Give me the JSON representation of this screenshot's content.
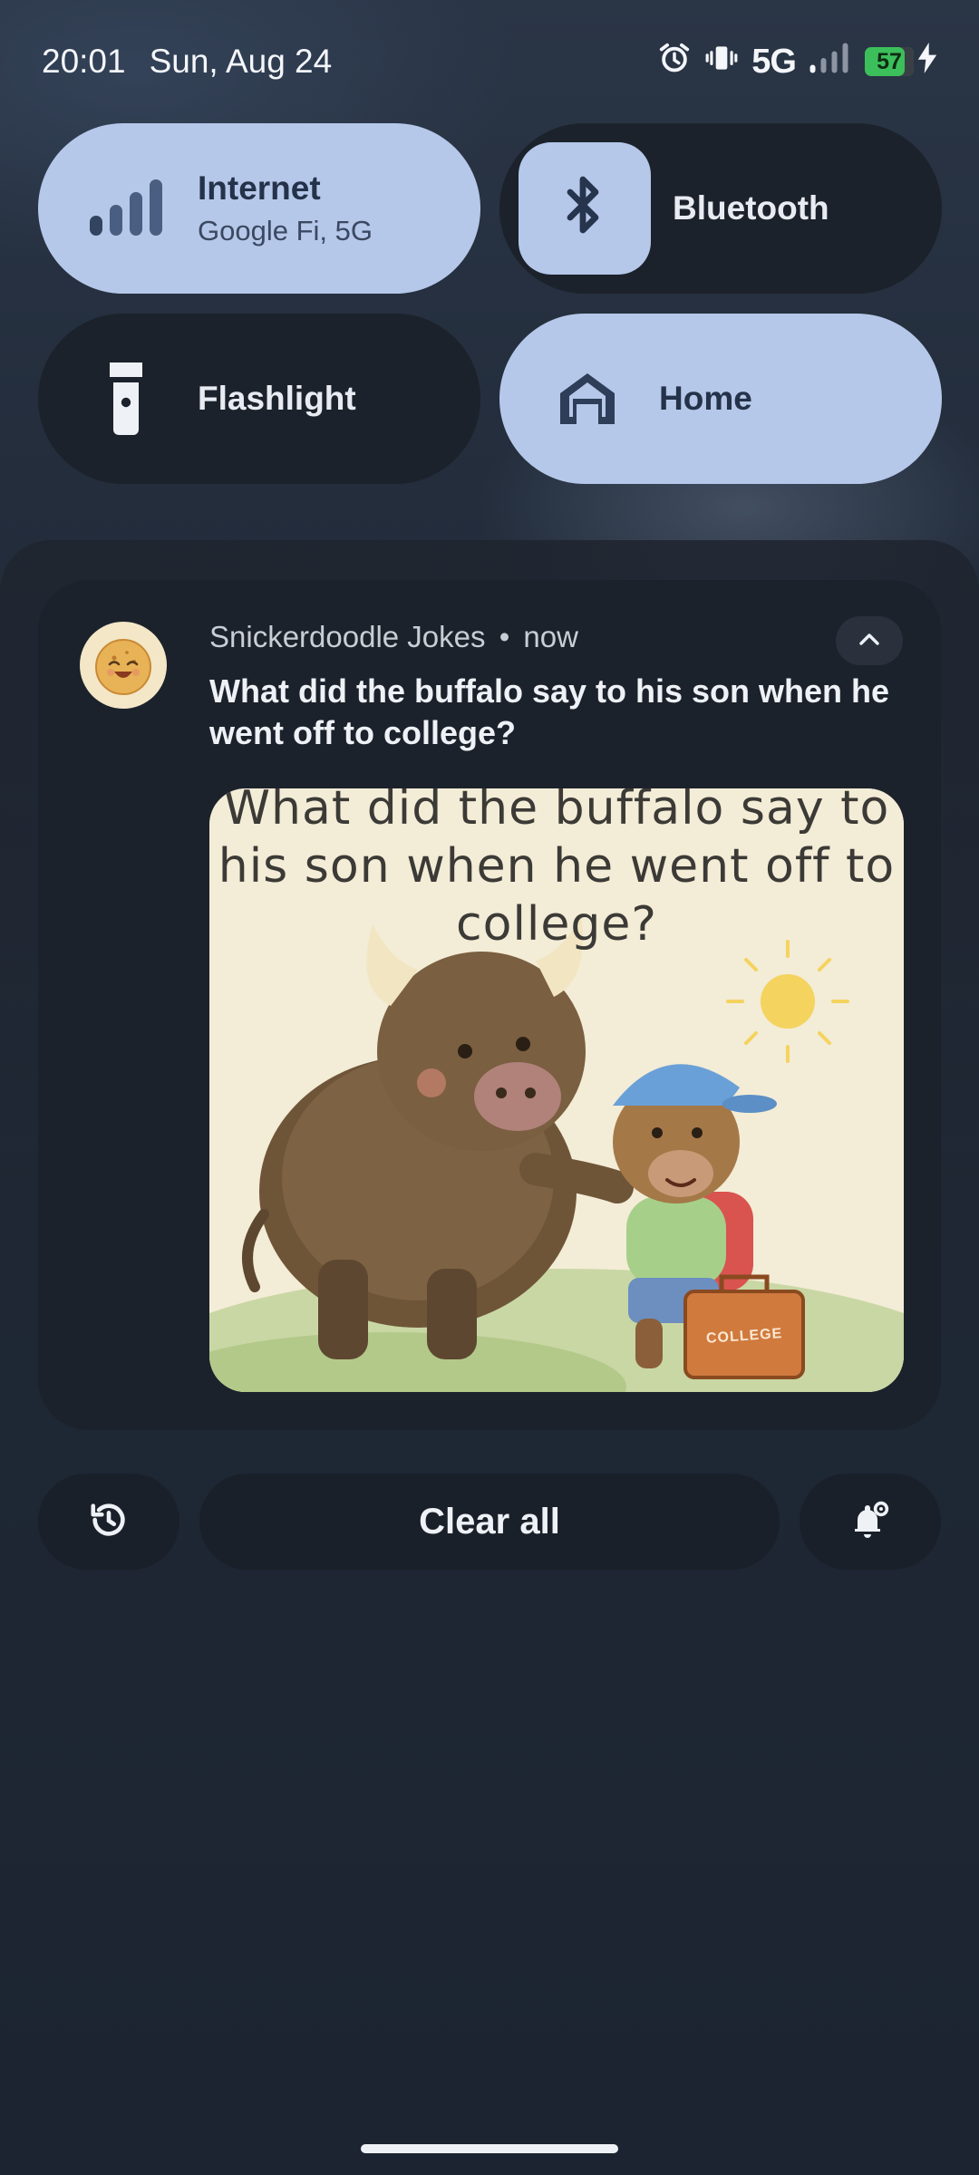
{
  "status_bar": {
    "time": "20:01",
    "date": "Sun, Aug 24",
    "network_type": "5G",
    "battery_level": "57",
    "icons": [
      "alarm-icon",
      "vibrate-icon",
      "signal-icon",
      "charging-icon"
    ]
  },
  "quick_settings": {
    "internet": {
      "label": "Internet",
      "subtitle": "Google Fi, 5G",
      "state": "on",
      "icon": "signal-bars-icon"
    },
    "bluetooth": {
      "label": "Bluetooth",
      "state": "off",
      "icon": "bluetooth-icon"
    },
    "flashlight": {
      "label": "Flashlight",
      "state": "off",
      "icon": "flashlight-icon"
    },
    "home": {
      "label": "Home",
      "state": "on",
      "icon": "home-icon"
    }
  },
  "notification": {
    "app_name": "Snickerdoodle Jokes",
    "separator": "•",
    "time": "now",
    "title": "What did the buffalo say to his son when he went off to college?",
    "image_caption": "What did the buffalo say to his son when he went off to college?",
    "suitcase_label": "COLLEGE"
  },
  "actions": {
    "clear_all_label": "Clear all",
    "history_icon": "history-icon",
    "settings_icon": "notification-settings-icon"
  },
  "colors": {
    "tile_on": "#b5c8e9",
    "tile_off": "#1c222b",
    "battery": "#3cbf5a"
  }
}
